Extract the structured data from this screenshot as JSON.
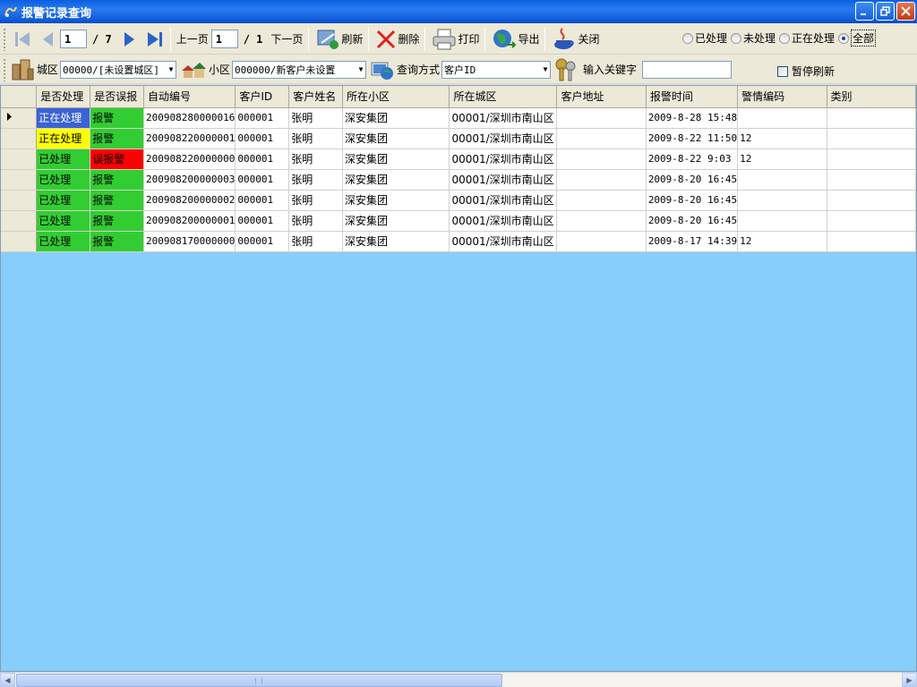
{
  "window": {
    "title": "报警记录查询"
  },
  "toolbar1": {
    "page_current": "1",
    "page_total": "/ 7",
    "prev_page_label": "上一页",
    "page_input2": "1",
    "page_total2": "/ 1",
    "next_page_label": "下一页",
    "refresh_label": "刷新",
    "delete_label": "删除",
    "print_label": "打印",
    "export_label": "导出",
    "close_label": "关闭",
    "filters": [
      {
        "label": "已处理",
        "selected": false
      },
      {
        "label": "未处理",
        "selected": false
      },
      {
        "label": "正在处理",
        "selected": false
      },
      {
        "label": "全部",
        "selected": true
      }
    ]
  },
  "toolbar2": {
    "city_label": "城区",
    "city_value": "00000/[未设置城区]",
    "district_label": "小区",
    "district_value": "000000/新客户未设置",
    "query_mode_label": "查询方式",
    "query_mode_value": "客户ID",
    "keyword_label": "输入关键字",
    "keyword_value": "",
    "pause_refresh_label": "暂停刷新"
  },
  "table": {
    "columns": [
      "是否处理",
      "是否误报",
      "自动编号",
      "客户ID",
      "客户姓名",
      "所在小区",
      "所在城区",
      "客户地址",
      "报警时间",
      "警情编码",
      "类别"
    ],
    "rows": [
      {
        "status": "正在处理",
        "status_color": "#3a63d6",
        "false_alarm": "报警",
        "fa_color": "#32cd32",
        "auto_no": "200908280000016",
        "cust_id": "000001",
        "name": "张明",
        "district": "深安集团",
        "city": "00001/深圳市南山区",
        "address": "",
        "time": "2009-8-28 15:48",
        "code": "",
        "category": "",
        "current": true
      },
      {
        "status": "正在处理",
        "status_color": "#ffff00",
        "false_alarm": "报警",
        "fa_color": "#32cd32",
        "auto_no": "200908220000001",
        "cust_id": "000001",
        "name": "张明",
        "district": "深安集团",
        "city": "00001/深圳市南山区",
        "address": "",
        "time": "2009-8-22 11:50",
        "code": "12",
        "category": "",
        "current": false
      },
      {
        "status": "已处理",
        "status_color": "#32cd32",
        "false_alarm": "误报警",
        "fa_color": "#ff0000",
        "auto_no": "200908220000000",
        "cust_id": "000001",
        "name": "张明",
        "district": "深安集团",
        "city": "00001/深圳市南山区",
        "address": "",
        "time": "2009-8-22 9:03",
        "code": "12",
        "category": "",
        "current": false
      },
      {
        "status": "已处理",
        "status_color": "#32cd32",
        "false_alarm": "报警",
        "fa_color": "#32cd32",
        "auto_no": "200908200000003",
        "cust_id": "000001",
        "name": "张明",
        "district": "深安集团",
        "city": "00001/深圳市南山区",
        "address": "",
        "time": "2009-8-20 16:45",
        "code": "",
        "category": "",
        "current": false
      },
      {
        "status": "已处理",
        "status_color": "#32cd32",
        "false_alarm": "报警",
        "fa_color": "#32cd32",
        "auto_no": "200908200000002",
        "cust_id": "000001",
        "name": "张明",
        "district": "深安集团",
        "city": "00001/深圳市南山区",
        "address": "",
        "time": "2009-8-20 16:45",
        "code": "",
        "category": "",
        "current": false
      },
      {
        "status": "已处理",
        "status_color": "#32cd32",
        "false_alarm": "报警",
        "fa_color": "#32cd32",
        "auto_no": "200908200000001",
        "cust_id": "000001",
        "name": "张明",
        "district": "深安集团",
        "city": "00001/深圳市南山区",
        "address": "",
        "time": "2009-8-20 16:45",
        "code": "",
        "category": "",
        "current": false
      },
      {
        "status": "已处理",
        "status_color": "#32cd32",
        "false_alarm": "报警",
        "fa_color": "#32cd32",
        "auto_no": "200908170000000",
        "cust_id": "000001",
        "name": "张明",
        "district": "深安集团",
        "city": "00001/深圳市南山区",
        "address": "",
        "time": "2009-8-17 14:39",
        "code": "12",
        "category": "",
        "current": false
      }
    ]
  },
  "colors": {
    "grid_background": "#87cefa",
    "title_bar": "#0a5fe0",
    "status_processing_current": "#3a63d6",
    "status_processing": "#ffff00",
    "handled": "#32cd32",
    "false_alarm": "#ff0000"
  }
}
